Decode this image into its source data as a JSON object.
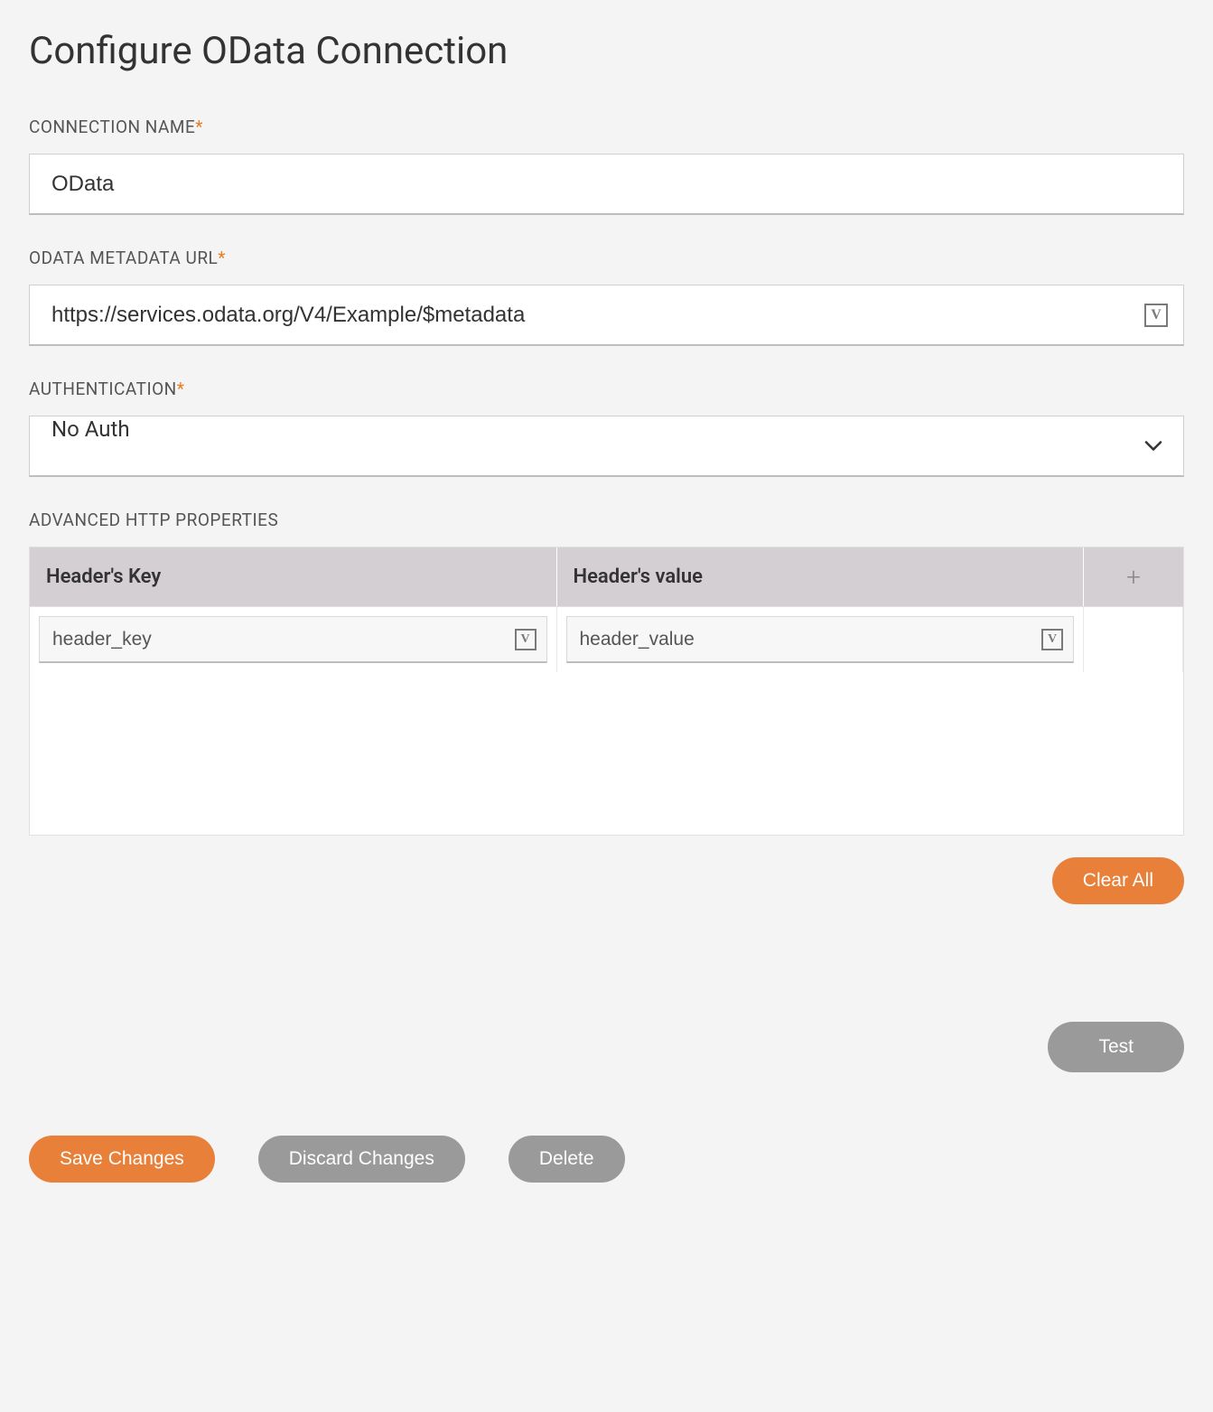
{
  "page_title": "Configure OData Connection",
  "fields": {
    "connection_name": {
      "label": "CONNECTION NAME",
      "required_mark": "*",
      "value": "OData"
    },
    "metadata_url": {
      "label": "ODATA METADATA URL",
      "required_mark": "*",
      "value": "https://services.odata.org/V4/Example/$metadata",
      "icon_glyph": "V"
    },
    "authentication": {
      "label": "AUTHENTICATION",
      "required_mark": "*",
      "value": "No Auth"
    },
    "advanced_http": {
      "label": "ADVANCED HTTP PROPERTIES",
      "columns": {
        "key": "Header's Key",
        "value": "Header's value"
      },
      "rows": [
        {
          "key": "header_key",
          "value": "header_value"
        }
      ],
      "add_icon": "+",
      "cell_icon_glyph": "V"
    }
  },
  "buttons": {
    "clear_all": "Clear All",
    "test": "Test",
    "save": "Save Changes",
    "discard": "Discard Changes",
    "delete": "Delete"
  }
}
